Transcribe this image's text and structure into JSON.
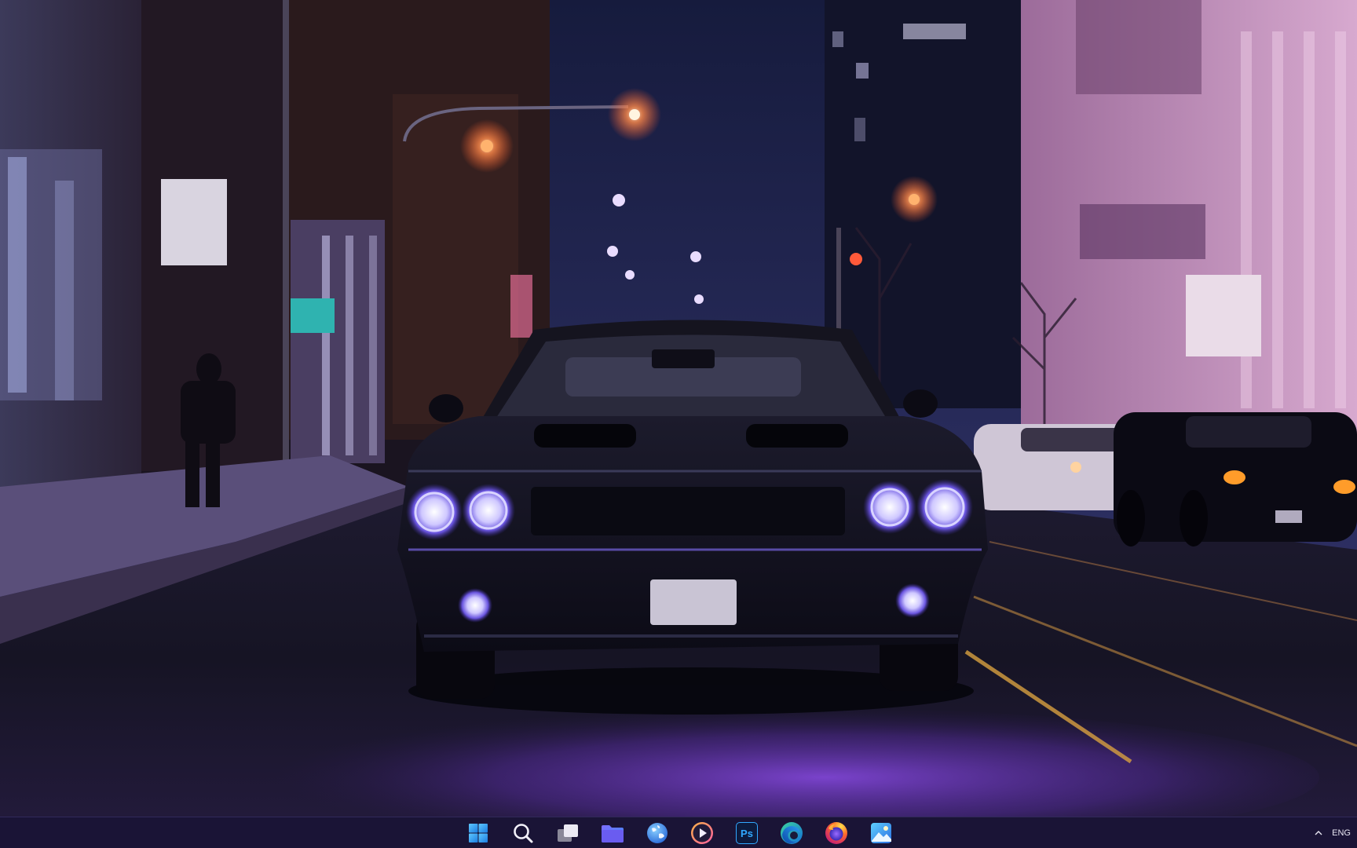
{
  "wallpaper": {
    "description_icon": "night-street-muscle-car-wallpaper",
    "colors": {
      "sky": "#1c2350",
      "purple_glow": "#7b3fd6",
      "pink_building": "#c58ab8",
      "headlight": "#c9c4ff",
      "street_light": "#ff7a3a"
    }
  },
  "taskbar": {
    "apps": [
      {
        "name": "start",
        "icon": "windows-logo-icon"
      },
      {
        "name": "search",
        "icon": "search-icon"
      },
      {
        "name": "task-view",
        "icon": "task-view-icon"
      },
      {
        "name": "file-explorer",
        "icon": "folder-icon"
      },
      {
        "name": "browser-globe",
        "icon": "globe-icon"
      },
      {
        "name": "media-player",
        "icon": "play-icon"
      },
      {
        "name": "photoshop",
        "icon": "photoshop-icon",
        "label": "Ps"
      },
      {
        "name": "edge",
        "icon": "edge-icon"
      },
      {
        "name": "firefox",
        "icon": "firefox-icon"
      },
      {
        "name": "photos",
        "icon": "photos-icon"
      }
    ],
    "tray": {
      "chevron_icon": "chevron-up-icon",
      "language": "ENG"
    }
  }
}
